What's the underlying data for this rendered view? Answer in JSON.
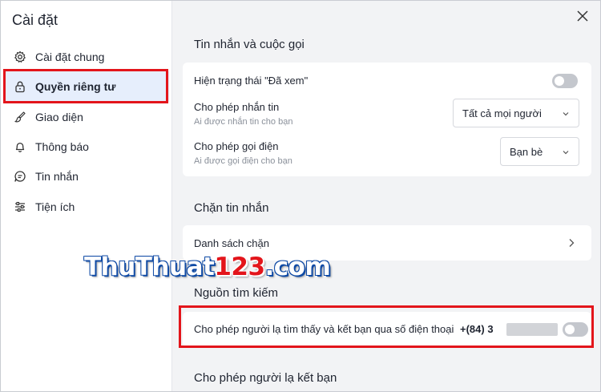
{
  "sidebar": {
    "title": "Cài đặt",
    "items": [
      {
        "label": "Cài đặt chung",
        "icon": "gear-icon"
      },
      {
        "label": "Quyền riêng tư",
        "icon": "lock-icon",
        "active": true
      },
      {
        "label": "Giao diện",
        "icon": "paint-brush-icon"
      },
      {
        "label": "Thông báo",
        "icon": "bell-icon"
      },
      {
        "label": "Tin nhắn",
        "icon": "chat-icon"
      },
      {
        "label": "Tiện ích",
        "icon": "sliders-icon"
      }
    ]
  },
  "main": {
    "close_icon": "close-icon",
    "messages_calls": {
      "title": "Tin nhắn và cuộc gọi",
      "seen_status": {
        "label": "Hiện trạng thái \"Đã xem\"",
        "enabled": false
      },
      "allow_messages": {
        "label": "Cho phép nhắn tin",
        "sub": "Ai được nhắn tin cho bạn",
        "value": "Tất cả mọi người"
      },
      "allow_calls": {
        "label": "Cho phép gọi điện",
        "sub": "Ai được gọi điện cho bạn",
        "value": "Bạn bè"
      }
    },
    "block": {
      "title": "Chặn tin nhắn",
      "block_list": "Danh sách chặn"
    },
    "search_source": {
      "title": "Nguồn tìm kiếm",
      "allow_phone_label": "Cho phép người lạ tìm thấy và kết bạn qua số điện thoại",
      "phone_prefix": "+(84) 3",
      "enabled": false
    },
    "allow_friends": {
      "title": "Cho phép người lạ kết bạn"
    }
  },
  "watermark": {
    "text": "ThuThuat",
    "number": "123",
    "suffix": ".com"
  },
  "colors": {
    "highlight": "#e3151b",
    "active_bg": "#e6eefc",
    "main_bg": "#f2f3f5",
    "toggle_off": "#c4c7cd"
  }
}
